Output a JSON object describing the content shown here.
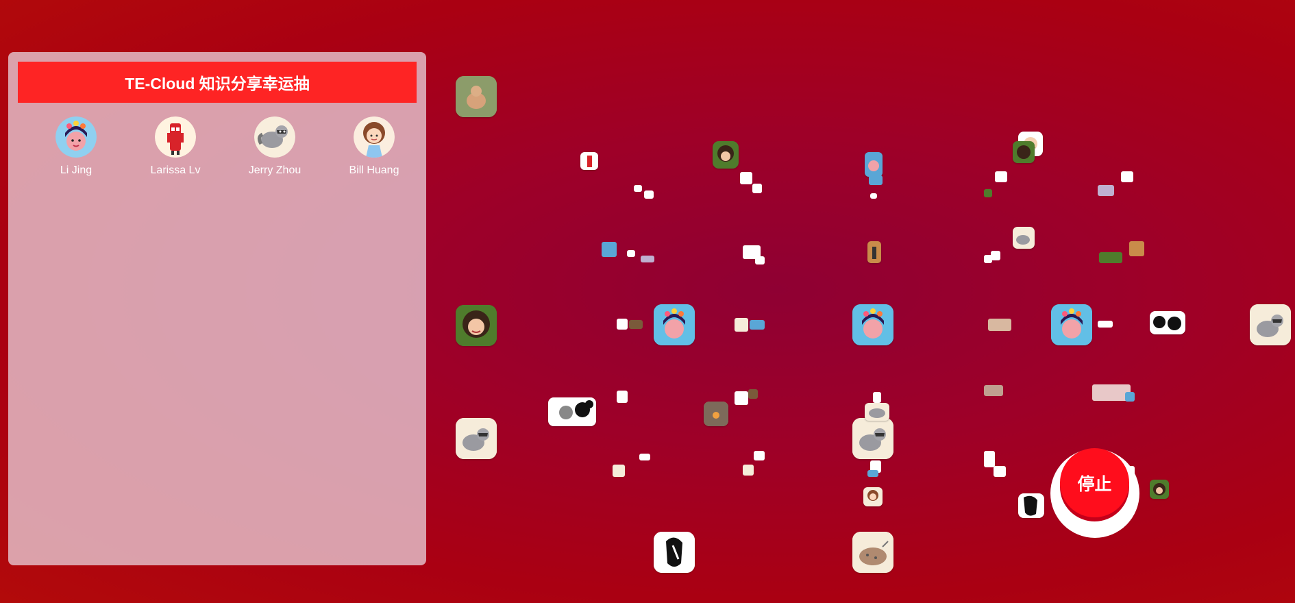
{
  "lottery": {
    "title": "TE-Cloud 知识分享幸运抽",
    "stop_label": "停止"
  },
  "winners": [
    {
      "name": "Li Jing",
      "avatar": "girl-flower-crown-icon"
    },
    {
      "name": "Larissa Lv",
      "avatar": "red-robot-icon"
    },
    {
      "name": "Jerry Zhou",
      "avatar": "raccoon-icon"
    },
    {
      "name": "Bill Huang",
      "avatar": "curly-girl-icon"
    }
  ],
  "colors": {
    "title_bar": "#fe2424",
    "stop_button": "#ff0d1c",
    "background": "#a5001a"
  }
}
